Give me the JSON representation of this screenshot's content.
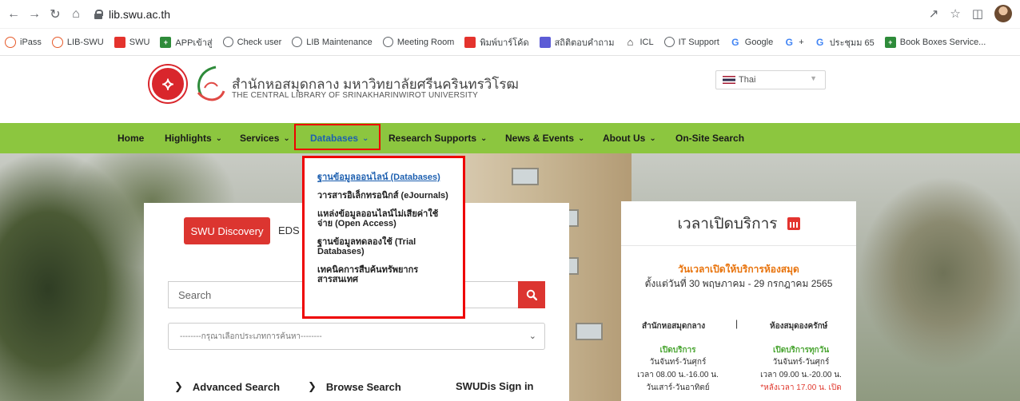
{
  "browser": {
    "url": "lib.swu.ac.th",
    "bookmarks": [
      "iPass",
      "LIB-SWU",
      "SWU",
      "APPเข้าสู่",
      "Check user",
      "LIB Maintenance",
      "Meeting Room",
      "พิมพ์บาร์โค้ด",
      "สถิติตอบคำถาม",
      "ICL",
      "IT Support",
      "Google",
      "+",
      "ประชุมม 65",
      "Book Boxes Service..."
    ]
  },
  "header": {
    "title_th": "สำนักหอสมุดกลาง มหาวิทยาลัยศรีนครินทรวิโรฒ",
    "title_en": "THE CENTRAL LIBRARY OF SRINAKHARINWIROT UNIVERSITY",
    "language": "Thai"
  },
  "nav": {
    "items": [
      "Home",
      "Highlights",
      "Services",
      "Databases",
      "Research Supports",
      "News & Events",
      "About Us",
      "On-Site Search"
    ],
    "active": "Databases"
  },
  "dropdown": {
    "items": [
      "ฐานข้อมูลออนไลน์ (Databases)",
      "วารสารอิเล็กทรอนิกส์ (eJournals)",
      "แหล่งข้อมูลออนไลน์ไม่เสียค่าใช้จ่าย (Open Access)",
      "ฐานข้อมูลทดลองใช้ (Trial Databases)",
      "เทคนิคการสืบค้นทรัพยากรสารสนเทศ"
    ]
  },
  "search": {
    "tab_active": "SWU Discovery",
    "tab_other": "EDS S",
    "placeholder": "Search",
    "type_select": "--------กรุณาเลือกประเภทการค้นหา--------",
    "links": [
      "Advanced Search",
      "Browse Search",
      "SWUDis Sign in"
    ]
  },
  "hours": {
    "title": "เวลาเปิดบริการ",
    "subtitle": "วันเวลาเปิดให้บริการห้องสมุด",
    "period": "ตั้งแต่วันที่ 30 พฤษภาคม - 29 กรกฎาคม 2565",
    "col1": {
      "heading": "สำนักหอสมุดกลาง",
      "status": "เปิดบริการ",
      "days": "วันจันทร์-วันศุกร์",
      "time": "เวลา 08.00 น.-16.00 น.",
      "weekend": "วันเสาร์-วันอาทิตย์"
    },
    "divider": "|",
    "col2": {
      "heading": "ห้องสมุดองครักษ์",
      "status": "เปิดบริการทุกวัน",
      "days": "วันจันทร์-วันศุกร์",
      "time": "เวลา 09.00 น.-20.00 น.",
      "note": "*หลังเวลา 17.00 น. เปิด"
    }
  },
  "colors": {
    "nav_green": "#8cc63f",
    "accent_red": "#dc3530",
    "link_blue": "#1e60b0",
    "highlight_red": "#ee0000"
  }
}
